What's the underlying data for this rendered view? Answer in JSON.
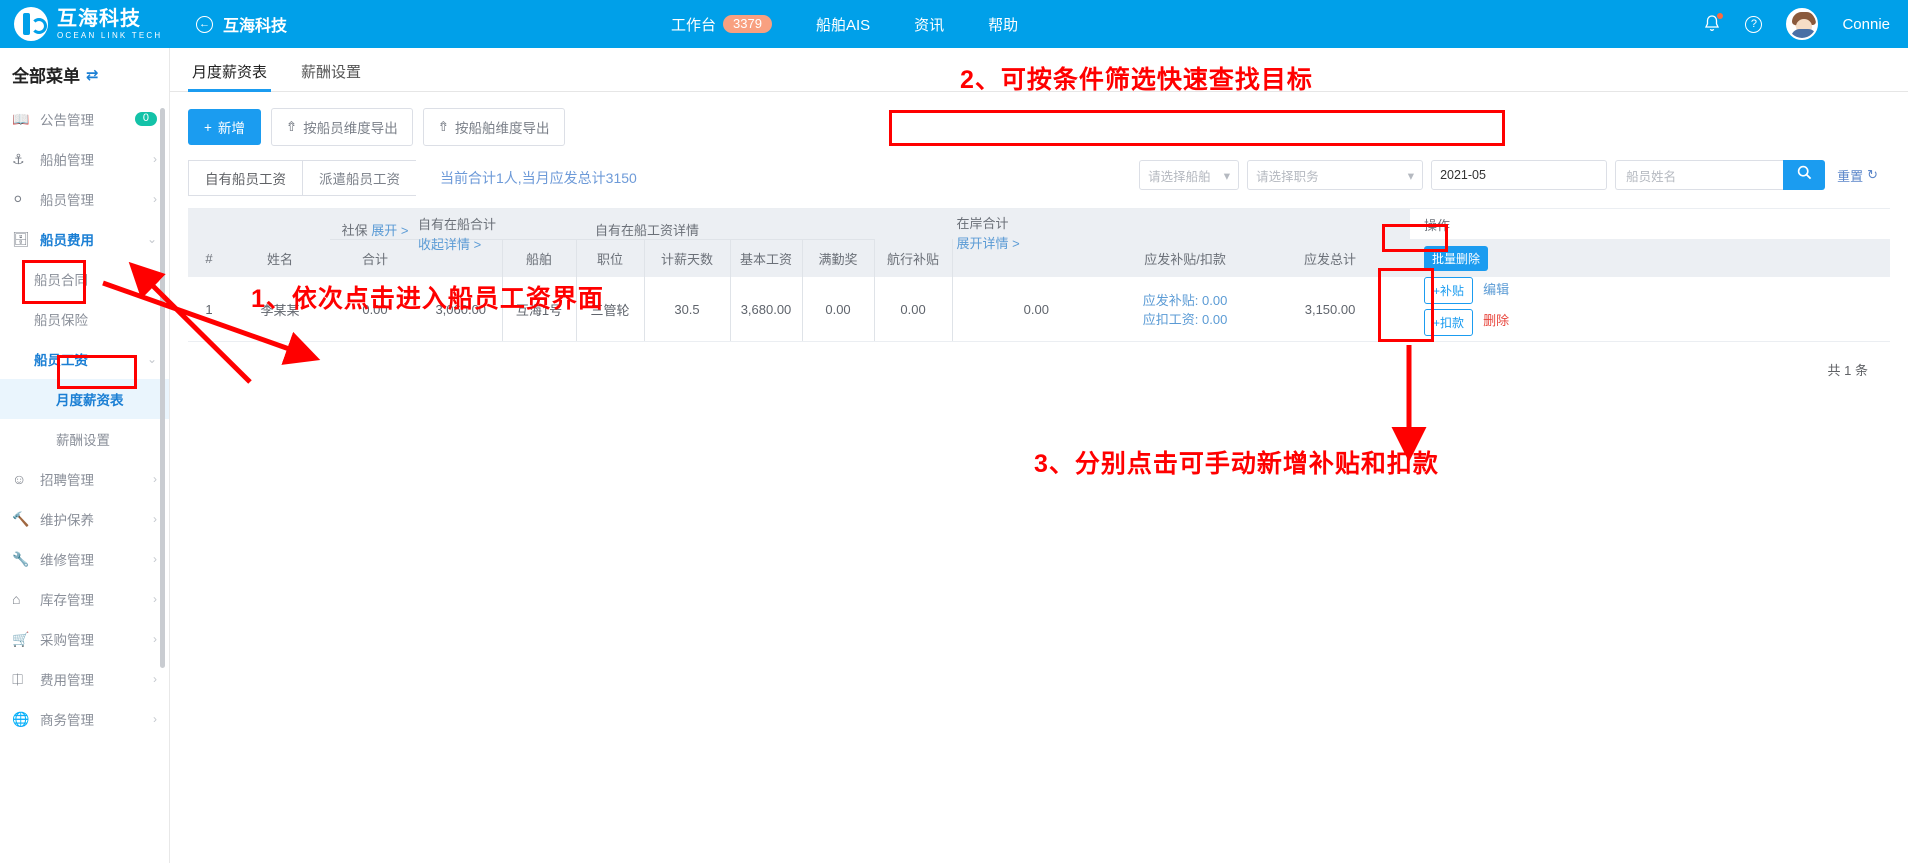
{
  "topbar": {
    "brand_cn": "互海科技",
    "brand_en": "OCEAN LINK TECH",
    "back_icon": "back-arrow-icon",
    "back_title": "互海科技",
    "nav": [
      {
        "label": "工作台",
        "badge": "3379"
      },
      {
        "label": "船舶AIS",
        "badge": ""
      },
      {
        "label": "资讯",
        "badge": ""
      },
      {
        "label": "帮助",
        "badge": ""
      }
    ],
    "bell_icon": "bell-icon",
    "help_icon": "question-circle-icon",
    "username": "Connie"
  },
  "sidebar": {
    "title": "全部菜单",
    "swap_icon": "swap-icon",
    "items": [
      {
        "label": "公告管理",
        "icon": "book-icon",
        "badge": "0",
        "arrow": "",
        "level": 0
      },
      {
        "label": "船舶管理",
        "icon": "anchor-icon",
        "badge": "",
        "arrow": "›",
        "level": 0
      },
      {
        "label": "船员管理",
        "icon": "user-icon",
        "badge": "",
        "arrow": "›",
        "level": 0
      },
      {
        "label": "船员费用",
        "icon": "wallet-icon",
        "badge": "",
        "arrow": "⌄",
        "level": 0,
        "active": true
      },
      {
        "label": "船员合同",
        "icon": "",
        "badge": "",
        "arrow": "",
        "level": 1
      },
      {
        "label": "船员保险",
        "icon": "",
        "badge": "",
        "arrow": "",
        "level": 1
      },
      {
        "label": "船员工资",
        "icon": "",
        "badge": "",
        "arrow": "⌄",
        "level": 1,
        "active": true
      },
      {
        "label": "月度薪资表",
        "icon": "",
        "badge": "",
        "arrow": "",
        "level": 2,
        "active": true,
        "selected": true
      },
      {
        "label": "薪酬设置",
        "icon": "",
        "badge": "",
        "arrow": "",
        "level": 2
      },
      {
        "label": "招聘管理",
        "icon": "user-plus-icon",
        "badge": "",
        "arrow": "›",
        "level": 0
      },
      {
        "label": "维护保养",
        "icon": "tool-icon",
        "badge": "",
        "arrow": "›",
        "level": 0
      },
      {
        "label": "维修管理",
        "icon": "wrench-icon",
        "badge": "",
        "arrow": "›",
        "level": 0
      },
      {
        "label": "库存管理",
        "icon": "home-icon",
        "badge": "",
        "arrow": "›",
        "level": 0
      },
      {
        "label": "采购管理",
        "icon": "cart-icon",
        "badge": "",
        "arrow": "›",
        "level": 0
      },
      {
        "label": "费用管理",
        "icon": "database-icon",
        "badge": "",
        "arrow": "›",
        "level": 0
      },
      {
        "label": "商务管理",
        "icon": "globe-icon",
        "badge": "",
        "arrow": "›",
        "level": 0
      }
    ]
  },
  "main": {
    "tabs": [
      {
        "label": "月度薪资表",
        "active": true
      },
      {
        "label": "薪酬设置",
        "active": false
      }
    ],
    "toolbar": {
      "add_label": "新增",
      "add_icon": "plus-icon",
      "export_crew_label": "按船员维度导出",
      "export_ship_label": "按船舶维度导出",
      "export_icon": "upload-icon"
    },
    "filter": {
      "ship_placeholder": "请选择船舶",
      "duty_placeholder": "请选择职务",
      "date_value": "2021-05",
      "name_placeholder": "船员姓名",
      "search_icon": "search-icon",
      "reset_label": "重置",
      "reset_icon": "refresh-icon",
      "dropdown_icon": "chevron-down-icon"
    },
    "subtabs": [
      {
        "label": "自有船员工资",
        "active": true
      },
      {
        "label": "派遣船员工资",
        "active": false
      }
    ],
    "summary": "当前合计1人,当月应发总计3150",
    "table": {
      "group_headers": {
        "social_insurance": "社保",
        "social_insurance_link": "展开 >",
        "own_onboard_total": "自有在船合计",
        "own_onboard_total_link": "收起详情 >",
        "own_onboard_detail": "自有在船工资详情",
        "onshore_total": "在岸合计",
        "onshore_total_link": "展开详情 >"
      },
      "columns": [
        "#",
        "姓名",
        "合计",
        "船舶",
        "职位",
        "计薪天数",
        "基本工资",
        "满勤奖",
        "航行补贴",
        "",
        "应发补贴/扣款",
        "应发总计",
        "操作"
      ],
      "op_header": "操作",
      "batch_delete_label": "批量删除",
      "rows": [
        {
          "index": "1",
          "name": "李某某",
          "social_total": "0.00",
          "own_total": "3,060.00",
          "ship": "互海1号",
          "position": "三管轮",
          "pay_days": "30.5",
          "base_salary": "3,680.00",
          "attendance_bonus": "0.00",
          "voyage_allowance": "0.00",
          "onshore_total": "0.00",
          "allowance_label": "应发补贴:",
          "allowance_value": "0.00",
          "deduction_label": "应扣工资:",
          "deduction_value": "0.00",
          "grand_total": "3,150.00",
          "op_add_allowance": "+补贴",
          "op_add_deduction": "+扣款",
          "op_edit": "编辑",
          "op_delete": "删除"
        }
      ],
      "footer_total": "共 1 条"
    }
  },
  "annotations": [
    {
      "id": "anno-1",
      "text": "1、依次点击进入船员工资界面"
    },
    {
      "id": "anno-2",
      "text": "2、可按条件筛选快速查找目标"
    },
    {
      "id": "anno-3",
      "text": "3、分别点击可手动新增补贴和扣款"
    }
  ],
  "colors": {
    "brand_blue": "#00a0e9",
    "accent_blue": "#1b9cf0",
    "annotation_red": "#ff0000",
    "badge_orange": "#f8a080",
    "badge_teal": "#13c2a8"
  }
}
